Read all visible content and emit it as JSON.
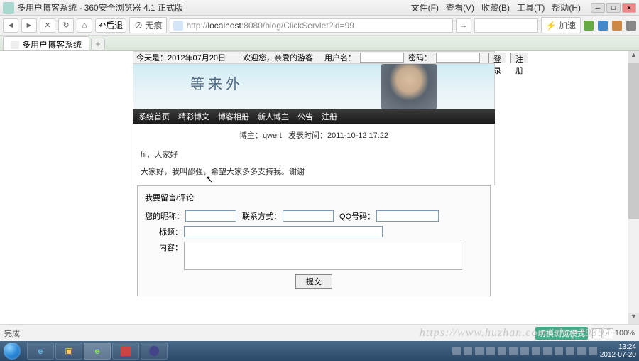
{
  "window": {
    "title": "多用户博客系统 - 360安全浏览器 4.1 正式版",
    "menus": [
      "文件(F)",
      "查看(V)",
      "收藏(B)",
      "工具(T)",
      "帮助(H)"
    ]
  },
  "toolbar": {
    "back_label": "后退",
    "refresh_label": "无痕",
    "url_prefix": "http://",
    "url_host": "localhost",
    "url_rest": ":8080/blog/ClickServlet?id=99",
    "action_label": "加速"
  },
  "tab": {
    "title": "多用户博客系统",
    "plus": "+"
  },
  "topbar": {
    "date_label": "今天是：",
    "date_value": "2012年07月20日",
    "welcome_label": "欢迎您，亲爱的游客",
    "user_label": "用户名：",
    "pass_label": "密码：",
    "login_btn": "登录",
    "reg_btn": "注册"
  },
  "banner": {
    "text": "等 来 外"
  },
  "nav": [
    "系统首页",
    "精彩博文",
    "博客相册",
    "新人博主",
    "公告",
    "注册"
  ],
  "meta": {
    "author_label": "博主：",
    "author": "qwert",
    "time_label": "发表时间：",
    "time": "2011-10-12 17:22"
  },
  "post": {
    "greeting": "hi，大家好",
    "body": "大家好，我叫邵强，希望大家多多支持我。谢谢"
  },
  "comment": {
    "head": "我要留言/评论",
    "nick_label": "您的昵称：",
    "contact_label": "联系方式：",
    "qq_label": "QQ号码：",
    "title_label": "标题：",
    "content_label": "内容：",
    "submit": "提交"
  },
  "status": {
    "done": "完成",
    "watermark": "https://www.huzhan.com/ishop39397",
    "mode": "切换浏览模式",
    "zoom": "100%"
  },
  "tray": {
    "time": "13:24",
    "date": "2012-07-20"
  }
}
